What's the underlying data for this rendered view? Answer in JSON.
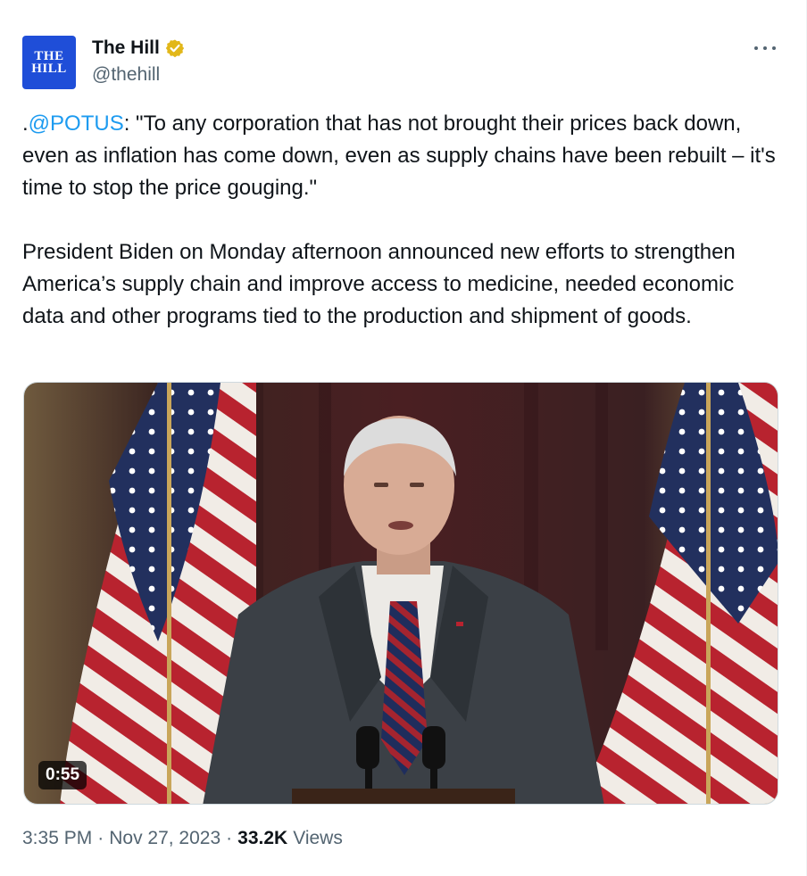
{
  "account": {
    "avatar_text_line1": "THE",
    "avatar_text_line2": "HILL",
    "display_name": "The Hill",
    "handle": "@thehill",
    "verified_icon": "verified-badge-icon",
    "verified_color": "#e2b719"
  },
  "more_icon": "more-horizontal-icon",
  "tweet": {
    "mention": "@POTUS",
    "line1_prefix": ".",
    "line1_rest": ": \"To any corporation that has not brought their prices back down, even as inflation has come down, even as supply chains have been rebuilt – it's time to stop the price gouging.\"",
    "paragraph2": "President Biden on Monday afternoon announced new efforts to strengthen America’s supply chain and improve access to medicine, needed economic data and other programs tied to the production and shipment of goods."
  },
  "media": {
    "duration": "0:55",
    "kind": "video"
  },
  "meta": {
    "time": "3:35 PM",
    "separator": "·",
    "date": "Nov 27, 2023",
    "views_count": "33.2K",
    "views_label": "Views"
  },
  "colors": {
    "accent": "#1d9bf0",
    "secondary_text": "#536471",
    "primary_text": "#0f1419"
  }
}
